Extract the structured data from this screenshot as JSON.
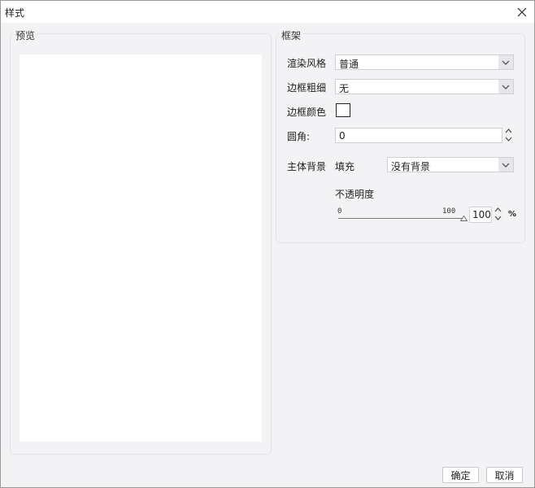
{
  "window": {
    "title": "样式",
    "close_icon": "close-icon"
  },
  "preview": {
    "legend": "预览"
  },
  "frame": {
    "legend": "框架",
    "render_style": {
      "label": "渲染风格",
      "value": "普通"
    },
    "border_width": {
      "label": "边框粗细",
      "value": "无"
    },
    "border_color": {
      "label": "边框颜色",
      "color": "#ffffff"
    },
    "corner_radius": {
      "label": "圆角:",
      "value": "0"
    },
    "body_background": {
      "label": "主体背景",
      "fill_label": "填充",
      "fill_value": "没有背景",
      "opacity_label": "不透明度",
      "slider_min": "0",
      "slider_max": "100",
      "opacity_value": "100",
      "opacity_unit": "%",
      "opacity_level": 1.0
    }
  },
  "footer": {
    "ok_label": "确定",
    "cancel_label": "取消"
  }
}
